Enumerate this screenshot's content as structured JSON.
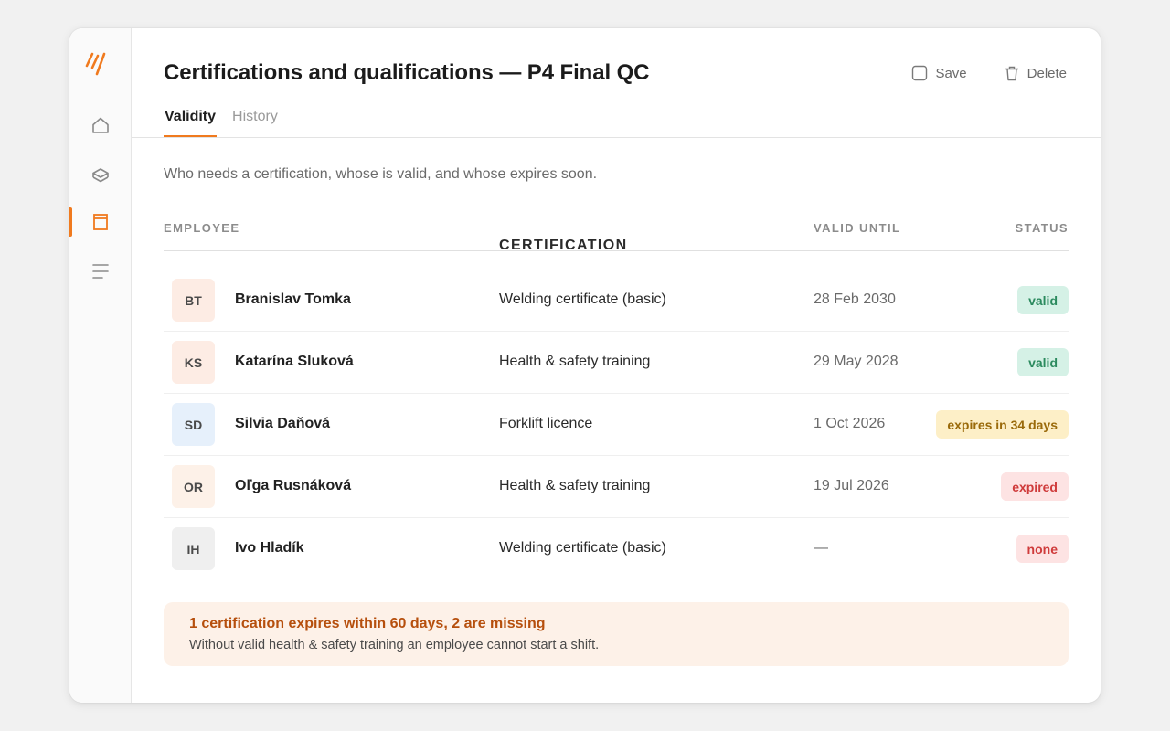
{
  "header": {
    "title": "Certifications and qualifications — P4 Final QC",
    "save_label": "Save",
    "delete_label": "Delete"
  },
  "tabs": [
    {
      "label": "Validity",
      "active": true
    },
    {
      "label": "History",
      "active": false
    }
  ],
  "sidebar": {
    "items": [
      {
        "icon": "home-icon",
        "active": false
      },
      {
        "icon": "layers-icon",
        "active": false
      },
      {
        "icon": "document-icon",
        "active": true
      },
      {
        "icon": "list-icon",
        "active": false
      }
    ]
  },
  "subtitle": "Who needs a certification, whose is valid, and whose expires soon.",
  "table": {
    "columns": [
      "EMPLOYEE",
      "CERTIFICATION",
      "VALID UNTIL",
      "STATUS"
    ],
    "rows": [
      {
        "initials": "BT",
        "name": "Branislav Tomka",
        "certification": "Welding certificate (basic)",
        "valid_until": "28 Feb 2030",
        "status": "valid",
        "avatar_bg": "#fdece4"
      },
      {
        "initials": "KS",
        "name": "Katarína Sluková",
        "certification": "Health & safety training",
        "valid_until": "29 May 2028",
        "status": "valid",
        "avatar_bg": "#fdece4"
      },
      {
        "initials": "SD",
        "name": "Silvia Daňová",
        "certification": "Forklift licence",
        "valid_until": "1 Oct 2026",
        "status": "expires in 34 days",
        "avatar_bg": "#e6f0fb"
      },
      {
        "initials": "OR",
        "name": "Oľga Rusnáková",
        "certification": "Health & safety training",
        "valid_until": "19 Jul 2026",
        "status": "expired",
        "avatar_bg": "#fdf1e8"
      },
      {
        "initials": "IH",
        "name": "Ivo Hladík",
        "certification": "Welding certificate (basic)",
        "valid_until": "—",
        "status": "none",
        "avatar_bg": "#efefef"
      }
    ]
  },
  "status_colors": {
    "valid": {
      "bg": "#d5f1e6",
      "fg": "#2b8a5e"
    },
    "expires": {
      "bg": "#fdefc7",
      "fg": "#9a6a0a"
    },
    "expired": {
      "bg": "#fde3e3",
      "fg": "#cf3b3b"
    },
    "none": {
      "bg": "#fde3e3",
      "fg": "#cf3b3b"
    }
  },
  "notice": {
    "title": "1 certification expires within 60 days, 2 are missing",
    "body": "Without valid health & safety training an employee cannot start a shift."
  },
  "colors": {
    "accent": "#f07a1e"
  }
}
